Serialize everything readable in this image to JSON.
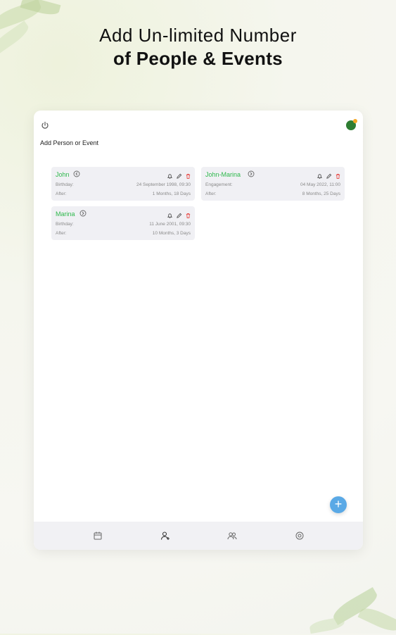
{
  "headline": {
    "line1": "Add Un-limited Number",
    "line2": "of People & Events"
  },
  "app": {
    "add_title": "Add Person or Event",
    "cards": [
      {
        "name": "John",
        "label1": "Birthday:",
        "value1": "24 September 1998, 09:30",
        "label2": "After:",
        "value2": "1 Months, 18 Days"
      },
      {
        "name": "John-Marina",
        "label1": "Engagement:",
        "value1": "04 May 2022, 11:00",
        "label2": "After:",
        "value2": "8 Months, 25 Days"
      },
      {
        "name": "Marina",
        "label1": "Birthday:",
        "value1": "11 June 2001, 09:30",
        "label2": "After:",
        "value2": "10 Months, 3 Days"
      }
    ],
    "fab_label": "+",
    "nav": [
      "calendar-icon",
      "person-add-icon",
      "people-icon",
      "settings-icon"
    ]
  },
  "colors": {
    "accent_green": "#2db84b",
    "fab_blue": "#5aa9e6",
    "delete_red": "#e53935"
  }
}
